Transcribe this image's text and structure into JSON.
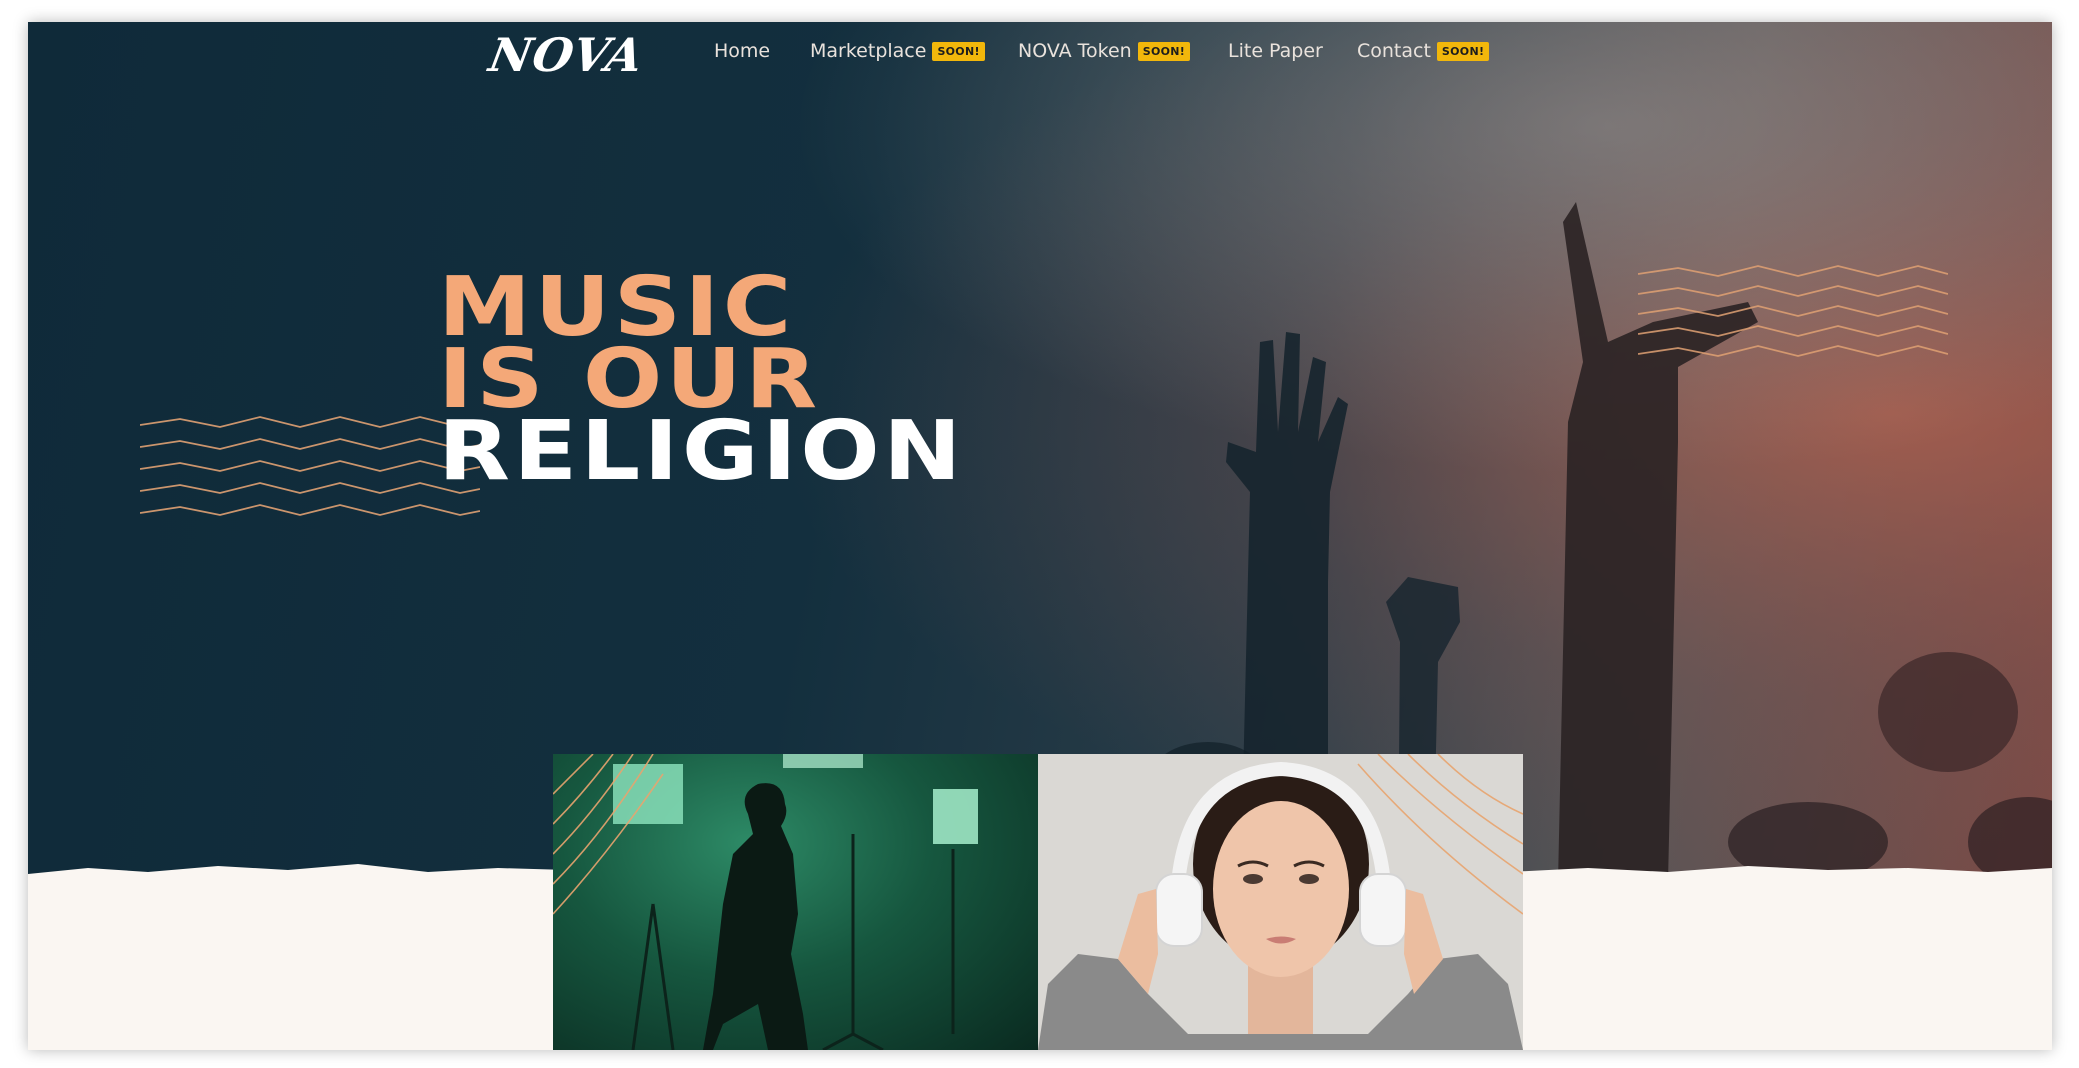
{
  "brand": {
    "logo_text": "NOVA"
  },
  "nav": {
    "items": [
      {
        "label": "Home",
        "badge": ""
      },
      {
        "label": "Marketplace",
        "badge": "SOON!"
      },
      {
        "label": "NOVA Token",
        "badge": "SOON!"
      },
      {
        "label": "Lite Paper",
        "badge": ""
      },
      {
        "label": "Contact",
        "badge": "SOON!"
      }
    ]
  },
  "hero": {
    "headline_line1": "MUSIC",
    "headline_line2": "IS OUR",
    "headline_line3": "RELIGION"
  },
  "images": {
    "left": "photo-singer-green-studio",
    "right": "photo-woman-white-headphones"
  },
  "colors": {
    "hero_dark": "#0f2a39",
    "accent_peach": "#f4a878",
    "badge_yellow": "#f2b70b",
    "page_cream": "#faf6f2",
    "studio_green": "#2d8a66"
  }
}
